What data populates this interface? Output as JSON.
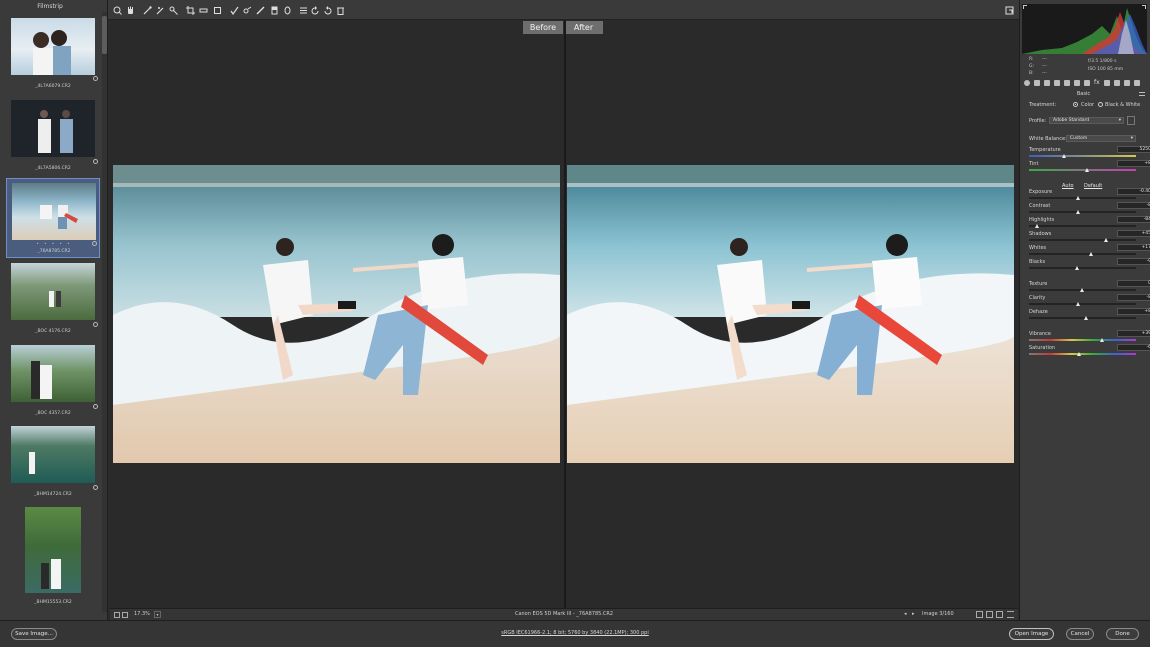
{
  "filmstrip": {
    "title": "Filmstrip",
    "items": [
      {
        "filename": "_4L7A6079.CR2",
        "selected": false,
        "stars": ""
      },
      {
        "filename": "_4L7A5806.CR2",
        "selected": false,
        "stars": ""
      },
      {
        "filename": "_76A8785.CR2",
        "selected": true,
        "stars": "• • • • •"
      },
      {
        "filename": "_BOC 4176.CR2",
        "selected": false,
        "stars": ""
      },
      {
        "filename": "_BOC 4357.CR2",
        "selected": false,
        "stars": ""
      },
      {
        "filename": "_BHM14724.CR2",
        "selected": false,
        "stars": ""
      },
      {
        "filename": "_BHM15553.CR2",
        "selected": false,
        "stars": ""
      }
    ]
  },
  "toolbar": {
    "tools": [
      "zoom-icon",
      "hand-icon",
      "white-balance-icon",
      "color-sampler-icon",
      "targeted-adjust-icon",
      "crop-icon",
      "straighten-icon",
      "transform-icon",
      "spot-removal-icon",
      "red-eye-icon",
      "brush-icon",
      "graduated-filter-icon",
      "radial-filter-icon",
      "presets-icon",
      "rotate-left-icon",
      "rotate-right-icon",
      "trash-icon"
    ]
  },
  "preview": {
    "before_label": "Before",
    "after_label": "After"
  },
  "statusbar": {
    "zoom": "17.3%",
    "camera_file": "Canon EOS 5D Mark III  -  _76A8785.CR2",
    "image_count": "Image 3/160"
  },
  "histogram_info": {
    "r_label": "R:",
    "g_label": "G:",
    "b_label": "B:",
    "dash": "---",
    "aperture_shutter": "f/3.5   1/800 s",
    "iso_focal": "ISO 100   85 mm"
  },
  "basic": {
    "section_title": "Basic",
    "treatment_label": "Treatment:",
    "treatment_color": "Color",
    "treatment_bw": "Black & White",
    "profile_label": "Profile:",
    "profile_value": "Adobe Standard",
    "white_balance_label": "White Balance:",
    "white_balance_value": "Custom",
    "auto_label": "Auto",
    "default_label": "Default",
    "sliders": [
      {
        "label": "Temperature",
        "value": "5250",
        "pos": 0.33
      },
      {
        "label": "Tint",
        "value": "+8",
        "pos": 0.55
      },
      {
        "label": "Exposure",
        "value": "-0.40",
        "pos": 0.46
      },
      {
        "label": "Contrast",
        "value": "-8",
        "pos": 0.46
      },
      {
        "label": "Highlights",
        "value": "-84",
        "pos": 0.08
      },
      {
        "label": "Shadows",
        "value": "+45",
        "pos": 0.72
      },
      {
        "label": "Whites",
        "value": "+17",
        "pos": 0.58
      },
      {
        "label": "Blacks",
        "value": "-9",
        "pos": 0.45
      },
      {
        "label": "Texture",
        "value": "0",
        "pos": 0.5
      },
      {
        "label": "Clarity",
        "value": "-8",
        "pos": 0.46
      },
      {
        "label": "Dehaze",
        "value": "+8",
        "pos": 0.54
      },
      {
        "label": "Vibrance",
        "value": "+39",
        "pos": 0.69
      },
      {
        "label": "Saturation",
        "value": "-6",
        "pos": 0.47
      }
    ]
  },
  "bottombar": {
    "save_label": "Save Image...",
    "workflow_label": "sRGB IEC61966-2.1; 8 bit; 5760 by 3840 (22.1MP); 300 ppi",
    "open_label": "Open Image",
    "cancel_label": "Cancel",
    "done_label": "Done"
  }
}
